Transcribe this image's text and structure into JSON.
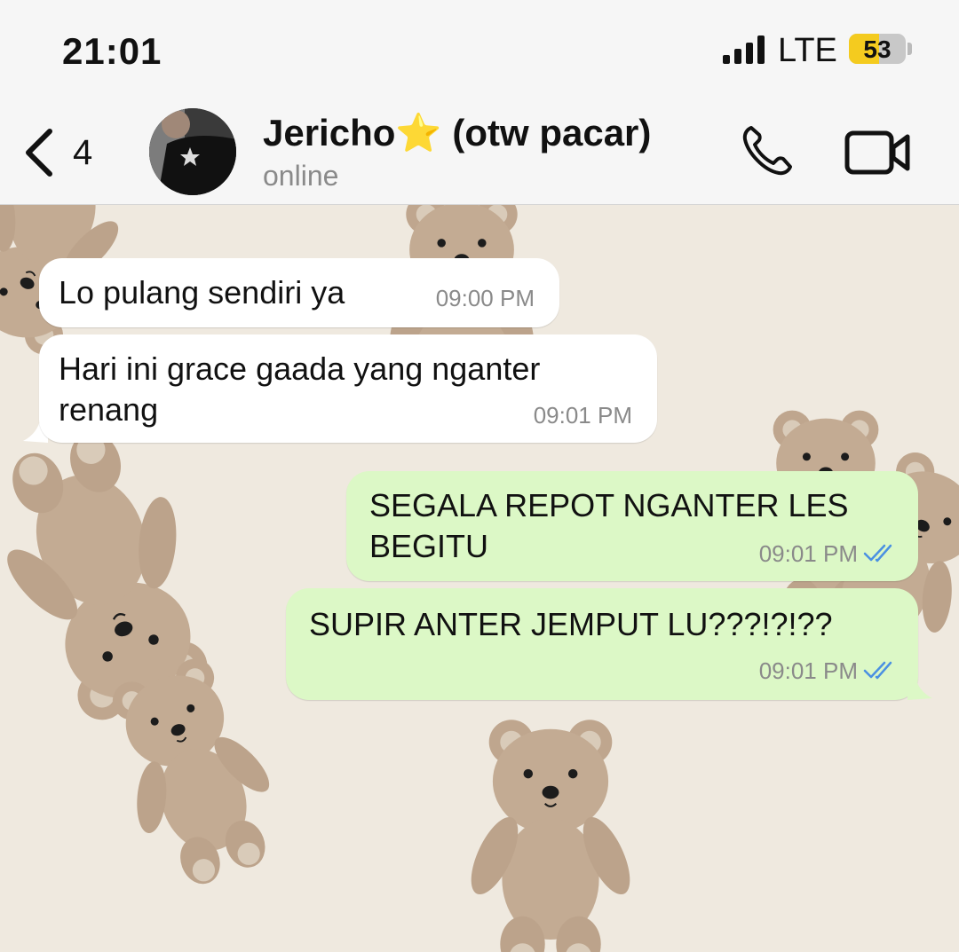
{
  "status_bar": {
    "time": "21:01",
    "network": "LTE",
    "battery": "53",
    "battery_level": 0.53,
    "signal_icon": "signal-bars-icon"
  },
  "header": {
    "back_count": "4",
    "contact_name": "Jericho⭐️ (otw pacar)",
    "contact_status": "online",
    "icons": {
      "back": "chevron-left-icon",
      "call": "phone-icon",
      "video": "video-camera-icon"
    }
  },
  "messages": [
    {
      "direction": "incoming",
      "text": "Lo pulang sendiri ya",
      "time": "09:00 PM"
    },
    {
      "direction": "incoming",
      "text": "Hari ini grace gaada yang nganter\nrenang",
      "time": "09:01 PM"
    },
    {
      "direction": "outgoing",
      "text": "SEGALA REPOT NGANTER LES\nBEGITU",
      "time": "09:01 PM",
      "status_icon": "double-check-icon"
    },
    {
      "direction": "outgoing",
      "text": "SUPIR ANTER JEMPUT LU???!?!??",
      "time": "09:01 PM",
      "status_icon": "double-check-icon"
    }
  ],
  "colors": {
    "incoming_bubble": "#ffffff",
    "outgoing_bubble": "#dcf8c6",
    "read_ticks": "#4a90e2",
    "battery": "#f4cb1f"
  }
}
